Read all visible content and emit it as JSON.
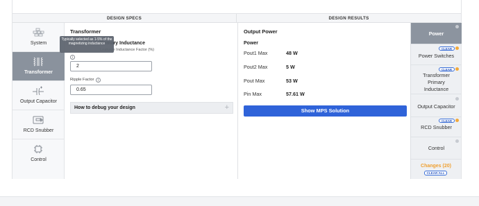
{
  "headers": {
    "specs": "DESIGN SPECS",
    "results": "DESIGN RESULTS"
  },
  "left_nav": [
    {
      "label": "System",
      "icon": "grid-icon",
      "active": false
    },
    {
      "label": "Transformer",
      "icon": "transformer-icon",
      "active": true
    },
    {
      "label": "Output Capacitor",
      "icon": "capacitor-icon",
      "active": false
    },
    {
      "label": "RCD Snubber",
      "icon": "snubber-icon",
      "active": false
    },
    {
      "label": "Control",
      "icon": "chip-icon",
      "active": false
    }
  ],
  "specs": {
    "section_title": "Transformer",
    "tooltip": "Typically selected as 1-5% of the magnetizing inductance",
    "field1_label": "Primary Inductance",
    "field1_sub": "Leakage Inductance Factor (%)",
    "field1_value": "2",
    "field2_label": "Ripple Factor",
    "field2_value": "0.65",
    "accordion_title": "How to debug your design"
  },
  "results": {
    "title": "Output Power",
    "sub": "Power",
    "rows": [
      {
        "key": "Pout1 Max",
        "value": "48 W"
      },
      {
        "key": "Pout2 Max",
        "value": "5 W"
      },
      {
        "key": "Pout Max",
        "value": "53 W"
      },
      {
        "key": "Pin Max",
        "value": "57.61 W"
      }
    ],
    "button": "Show MPS Solution"
  },
  "right_nav": {
    "items": [
      {
        "label": "Power",
        "badge": "",
        "dot": "grey",
        "active": true
      },
      {
        "label": "Power Switches",
        "badge": "CLEAR",
        "dot": "orange"
      },
      {
        "label": "Transformer Primary Inductance",
        "badge": "CLEAR",
        "dot": "orange"
      },
      {
        "label": "Output Capacitor",
        "badge": "",
        "dot": "grey"
      },
      {
        "label": "RCD Snubber",
        "badge": "CLEAR",
        "dot": "orange"
      },
      {
        "label": "Control",
        "badge": "",
        "dot": "grey"
      }
    ],
    "changes": "Changes (20)",
    "clear_all": "CLEAR ALL"
  },
  "colors": {
    "accent": "#2f63d9",
    "active_nav": "#8a929d",
    "changes": "#f0a030"
  }
}
